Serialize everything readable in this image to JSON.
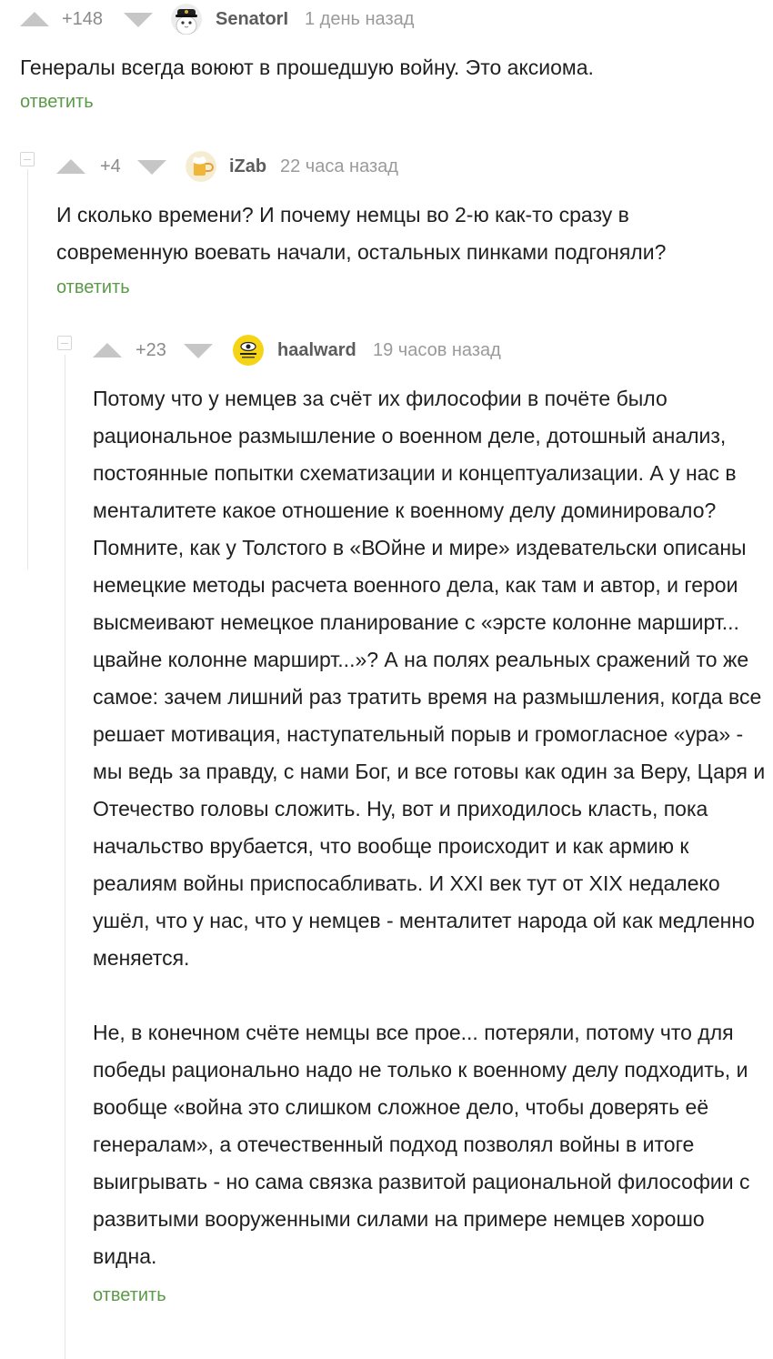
{
  "comments": [
    {
      "rating": "+148",
      "author": "SenatorI",
      "time": "1 день назад",
      "avatar_icon": "cat-in-captain-hat-avatar",
      "text": "Генералы всегда воюют в прошедшую войну. Это аксиома.",
      "reply_label": "ответить"
    },
    {
      "rating": "+4",
      "author": "iZab",
      "time": "22 часа назад",
      "avatar_icon": "beer-mug-avatar",
      "text": "И сколько времени? И почему немцы во 2-ю как-то сразу в современную воевать начали, остальных пинками подгоняли?",
      "reply_label": "ответить"
    },
    {
      "rating": "+23",
      "author": "haalward",
      "time": "19 часов назад",
      "avatar_icon": "yellow-eye-badge-avatar",
      "paragraphs": [
        "Потому что у немцев за счёт их философии в почёте было рациональное размышление о военном деле, дотошный анализ, постоянные попытки схематизации и концептуализации. А у нас в менталитете какое отношение к военному делу доминировало? Помните, как у Толстого в «ВОйне и мире» издевательски описаны немецкие методы расчета военного дела, как там и автор, и герои высмеивают немецкое планирование с «эрсте колонне марширт... цвайне колонне марширт...»? А на полях реальных сражений то же самое: зачем лишний раз тратить время на размышления, когда все решает мотивация, наступательный порыв и громогласное «ура» - мы ведь за правду, с нами Бог, и все готовы как один за Веру, Царя и Отечество головы сложить. Ну, вот и приходилось класть, пока начальство врубается, что вообще происходит и как армию к реалиям войны приспосабливать. И XXI век тут от XIX недалеко ушёл, что у нас, что у немцев - менталитет народа ой как медленно меняется.",
        "Не, в конечном счёте немцы все прое... потеряли, потому что для победы рационально надо не только к военному делу подходить, и вообще «война это слишком сложное дело, чтобы доверять её генералам», а отечественный подход позволял войны в итоге выигрывать - но сама связка развитой рациональной философии с развитыми вооруженными силами на примере немцев хорошо видна."
      ],
      "reply_label": "ответить"
    }
  ],
  "colors": {
    "reply_green": "#5b9a49",
    "vote_arrow_gray": "#c6c6c6",
    "meta_gray": "#9a9a9a",
    "author_gray": "#5c5c5c"
  }
}
